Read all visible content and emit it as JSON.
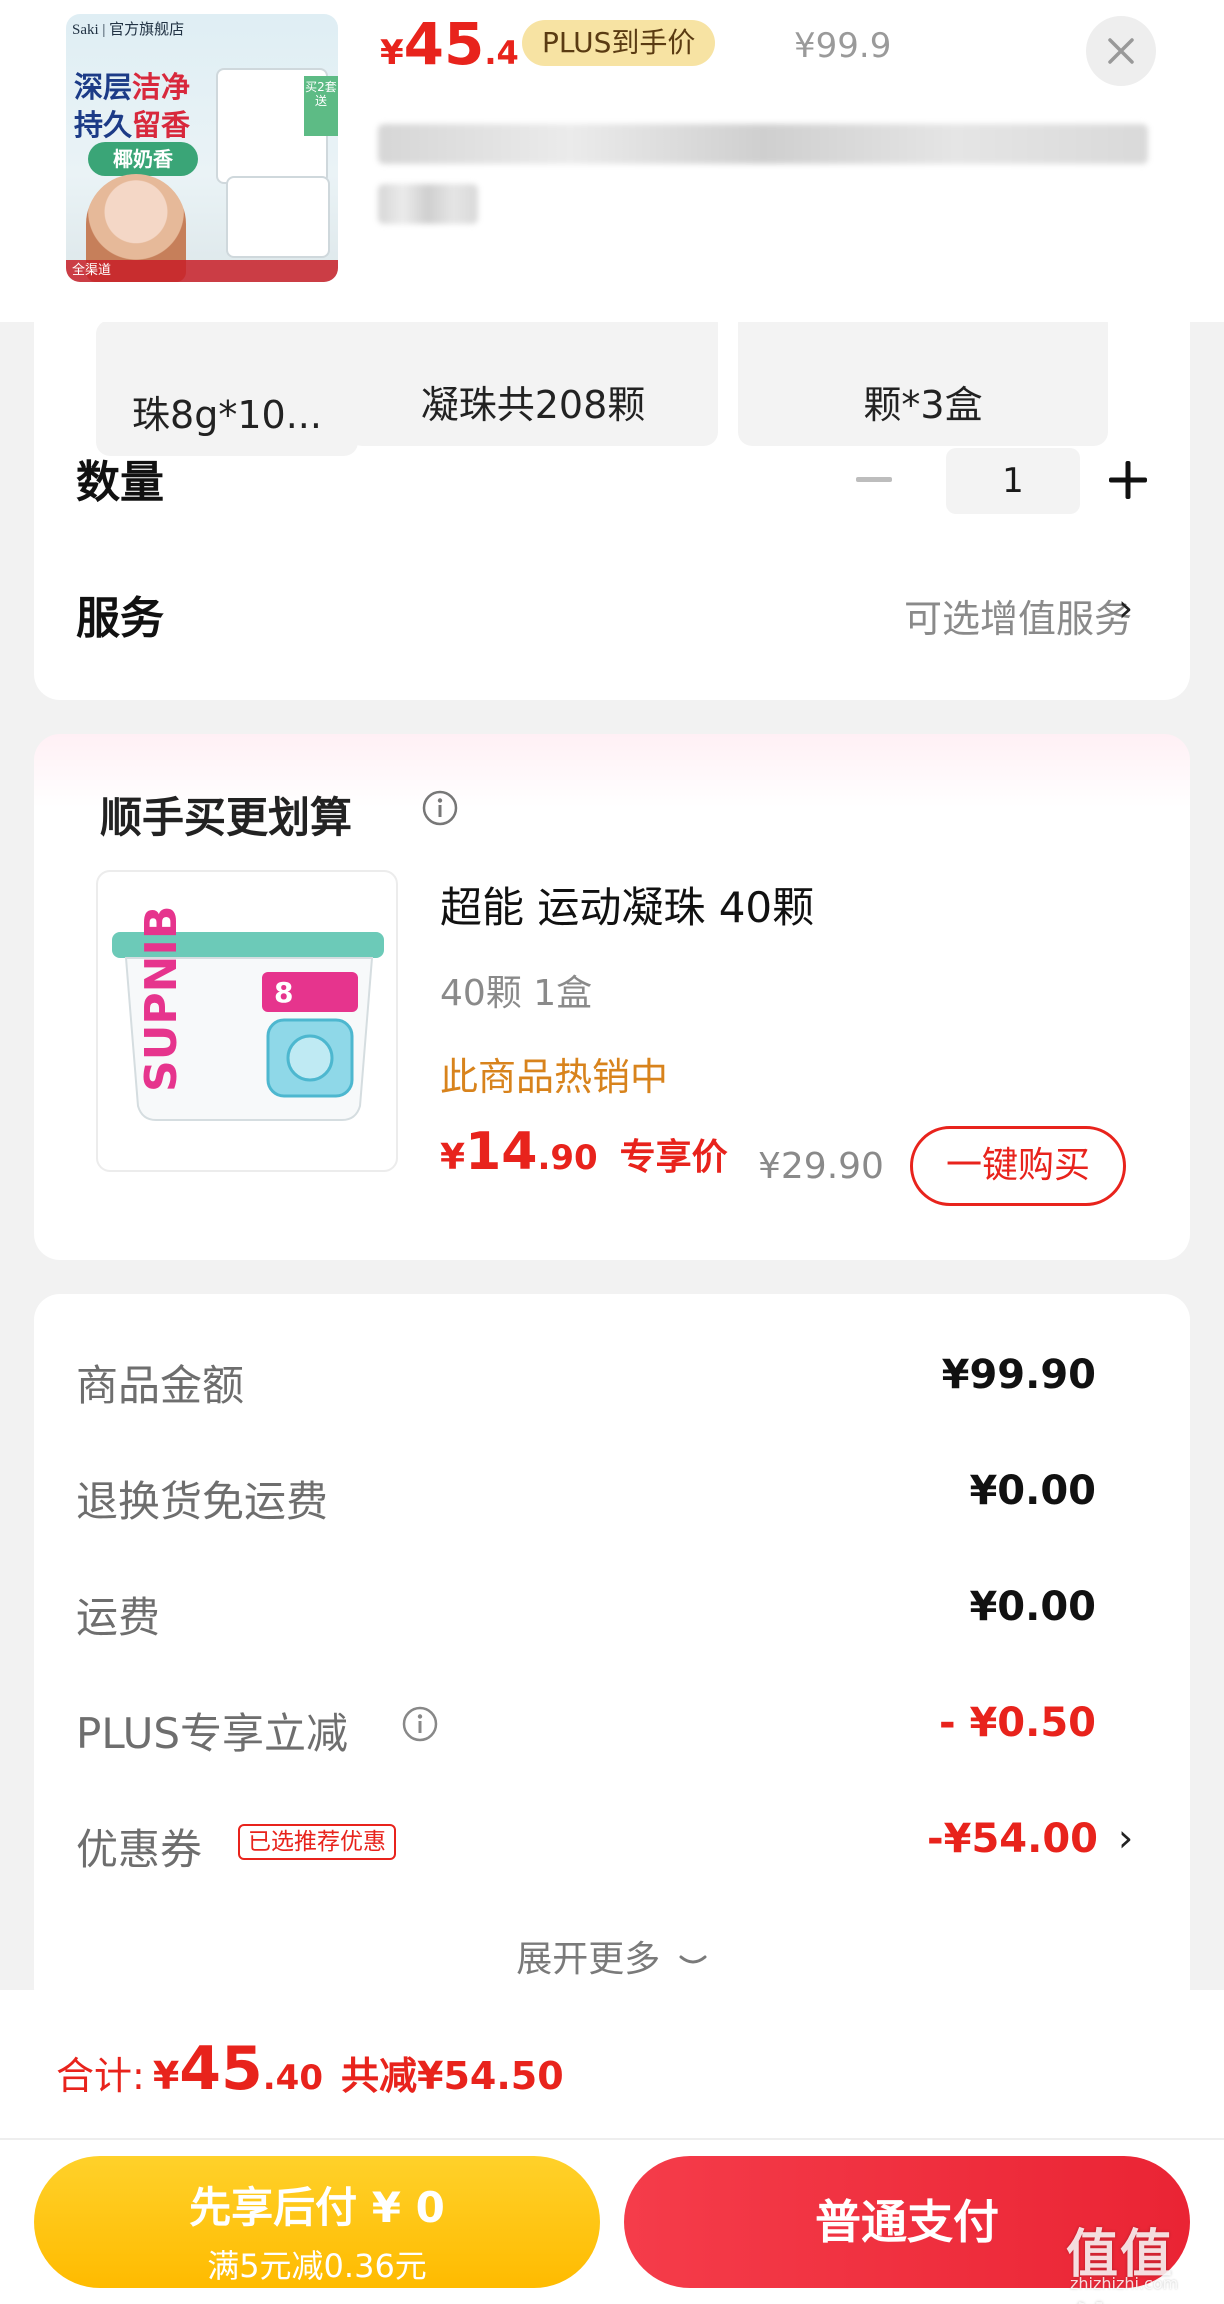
{
  "header": {
    "thumb": {
      "brand": "Saki | 官方旗舰店",
      "slogan_line1_a": "深层",
      "slogan_line1_b": "洁净",
      "slogan_line2_a": "持久",
      "slogan_line2_b": "留香",
      "scent": "椰奶香",
      "badge": "买2套送",
      "footer": "全渠道"
    },
    "price": {
      "currency": "¥",
      "integer": "45",
      "decimal": ".4"
    },
    "plus_tag": "PLUS到手价",
    "original_price": "¥99.9",
    "close_icon": "close-icon"
  },
  "spec": {
    "chips": [
      "珠8g*10...",
      "凝珠共208颗",
      "颗*3盒"
    ],
    "quantity_label": "数量",
    "quantity_value": "1",
    "service_label": "服务",
    "service_link": "可选增值服务"
  },
  "bundle": {
    "title": "顺手买更划算",
    "product": {
      "name": "超能 运动凝珠 40颗",
      "spec": "40颗 1盒",
      "hot": "此商品热销中",
      "price_currency": "¥",
      "price_integer": "14",
      "price_decimal": ".90",
      "price_label": "专享价",
      "original_price": "¥29.90",
      "image_label": "8"
    },
    "buy_button": "一键购买"
  },
  "summary": {
    "rows": [
      {
        "label": "商品金额",
        "value": "¥99.90"
      },
      {
        "label": "退换货免运费",
        "value": "¥0.00"
      },
      {
        "label": "运费",
        "value": "¥0.00"
      },
      {
        "label": "PLUS专享立减",
        "value": "- ¥0.50"
      },
      {
        "label": "优惠券",
        "value": "-¥54.00"
      }
    ],
    "coupon_tag": "已选推荐优惠",
    "expand": "展开更多"
  },
  "bottom": {
    "total_label": "合计:",
    "total_currency": "¥",
    "total_integer": "45",
    "total_decimal": ".40",
    "total_saved": "共减¥54.50",
    "pay_later_title": "先享后付 ¥ 0",
    "pay_later_sub": "满5元减0.36元",
    "pay_normal": "普通支付"
  },
  "watermark": {
    "main": "值值值",
    "sub": "zhizhizhi.com"
  },
  "colors": {
    "accent_red": "#e8231c",
    "plus_gold": "#f7e3a3",
    "pay_later_yellow": "#ffc400",
    "hot_orange": "#d8831c"
  }
}
